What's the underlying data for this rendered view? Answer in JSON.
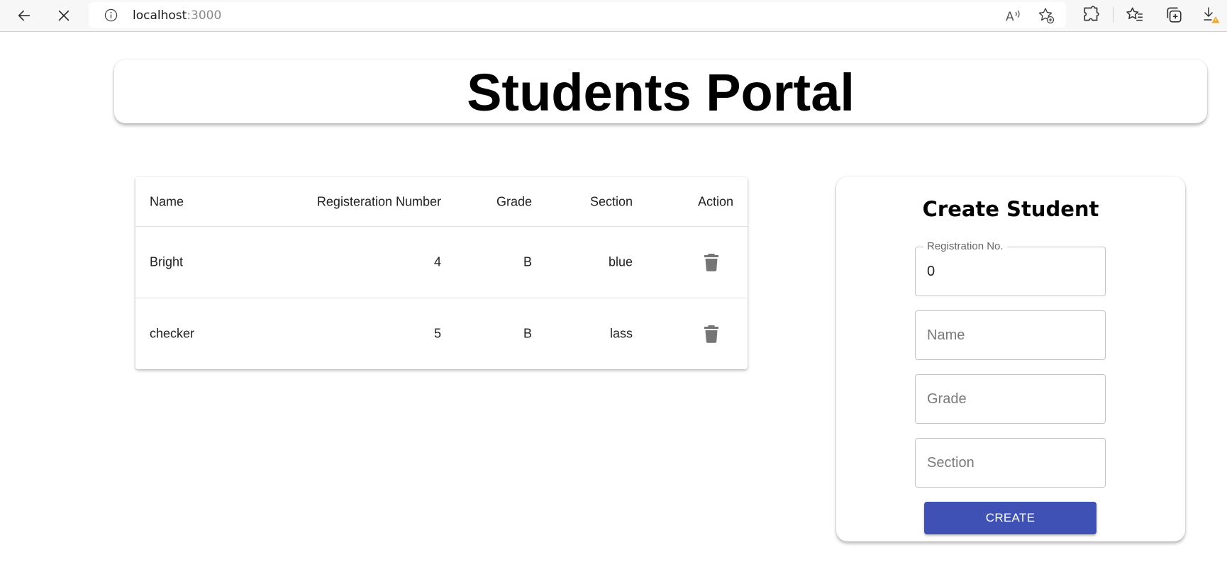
{
  "browser": {
    "url_host": "localhost",
    "url_port": ":3000"
  },
  "header": {
    "title": "Students Portal"
  },
  "table": {
    "columns": [
      "Name",
      "Registeration Number",
      "Grade",
      "Section",
      "Action"
    ],
    "rows": [
      {
        "name": "Bright",
        "reg": "4",
        "grade": "B",
        "section": "blue"
      },
      {
        "name": "checker",
        "reg": "5",
        "grade": "B",
        "section": "lass"
      }
    ]
  },
  "form": {
    "title": "Create Student",
    "registration_label": "Registration No.",
    "registration_value": "0",
    "name_placeholder": "Name",
    "grade_placeholder": "Grade",
    "section_placeholder": "Section",
    "create_label": "CREATE"
  },
  "colors": {
    "primary": "#3f51b5",
    "delete_icon": "#757575"
  },
  "icons": {
    "back": "back-arrow-icon",
    "stop": "close-icon",
    "info": "info-icon",
    "read_aloud": "read-aloud-icon",
    "favorite_add": "add-favorite-icon",
    "extensions": "extensions-icon",
    "favorites": "favorites-icon",
    "collections": "collections-icon",
    "downloads": "download-warning-icon",
    "delete": "trash-icon"
  }
}
